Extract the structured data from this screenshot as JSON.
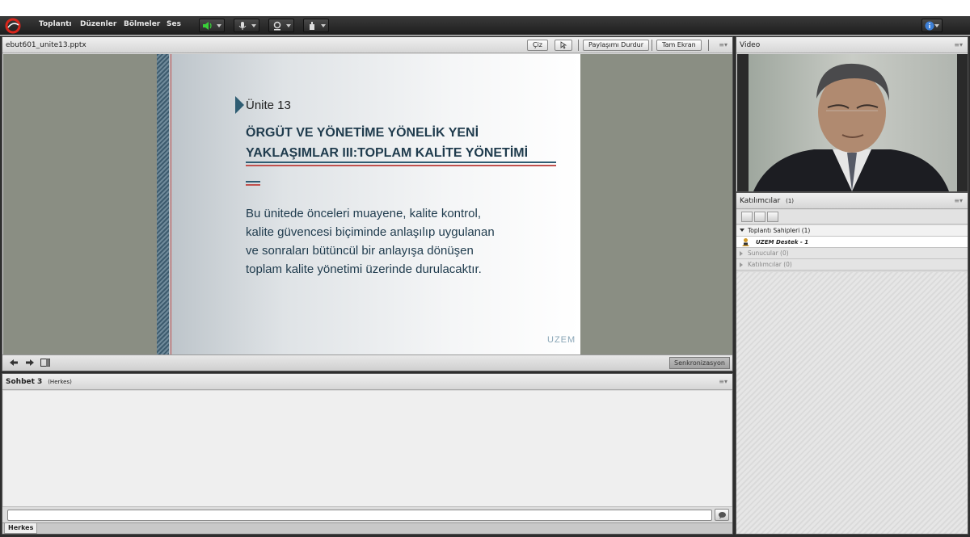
{
  "menu": {
    "items": [
      "Toplantı",
      "Düzenler",
      "Bölmeler",
      "Ses"
    ]
  },
  "share_pod": {
    "title": "ebut601_unite13.pptx",
    "buttons": {
      "draw": "Çiz",
      "stop_sharing": "Paylaşımı Durdur",
      "fullscreen": "Tam Ekran"
    },
    "sync_button": "Senkronizasyon"
  },
  "slide": {
    "unit": "Ünite 13",
    "title_line1": "ÖRGÜT VE YÖNETİME YÖNELİK YENİ",
    "title_line2": "YAKLAŞIMLAR III:TOPLAM KALİTE YÖNETİMİ",
    "body_lines": [
      "Bu ünitede önceleri muayene, kalite kontrol,",
      "kalite güvencesi biçiminde anlaşılıp uygulanan",
      "ve sonraları bütüncül bir anlayışa dönüşen",
      "toplam kalite yönetimi üzerinde durulacaktır."
    ],
    "logo": "UZEM"
  },
  "chat_pod": {
    "title": "Sohbet 3",
    "audience": "(Herkes)",
    "tab": "Herkes"
  },
  "video_pod": {
    "title": "Video"
  },
  "attendees_pod": {
    "title": "Katılımcılar",
    "count": "(1)",
    "groups": [
      {
        "label": "Toplantı Sahipleri (1)",
        "expanded": true
      },
      {
        "label": "Sunucular (0)",
        "expanded": false
      },
      {
        "label": "Katılımcılar (0)",
        "expanded": false
      }
    ],
    "host_name": "UZEM Destek - 1"
  },
  "colors": {
    "topbar": "#2a2a2a",
    "slide_accent": "#2f5d73",
    "slide_red": "#c0504d",
    "share_bg": "#8a8e83"
  }
}
